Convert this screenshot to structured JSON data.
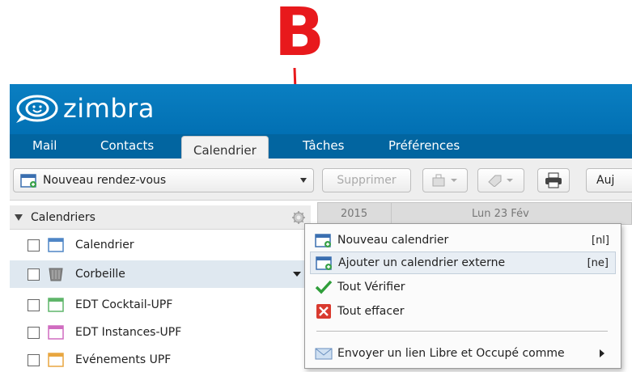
{
  "annotation": {
    "letter": "B",
    "color": "#e8191c"
  },
  "app": {
    "logo_text": "zimbra",
    "header_color": "#0a7fc2"
  },
  "tabs": [
    {
      "label": "Mail"
    },
    {
      "label": "Contacts"
    },
    {
      "label": "Calendrier",
      "active": true
    },
    {
      "label": "Tâches"
    },
    {
      "label": "Préférences"
    }
  ],
  "toolbar": {
    "new_appointment": "Nouveau rendez-vous",
    "delete": "Supprimer",
    "today": "Auj"
  },
  "view_header": {
    "year": "2015",
    "day": "Lun 23 Fév"
  },
  "sidebar": {
    "title": "Calendriers",
    "calendars": [
      {
        "label": "Calendrier",
        "color": "#4f86c6",
        "icon": "calendar-icon"
      },
      {
        "label": "Corbeille",
        "icon": "trash-icon",
        "selected": true
      },
      {
        "label": "EDT Cocktail-UPF",
        "color": "#5fb56a",
        "icon": "calendar-icon"
      },
      {
        "label": "EDT Instances-UPF",
        "color": "#d06cc0",
        "icon": "calendar-icon"
      },
      {
        "label": "Evénements UPF",
        "color": "#e8a640",
        "icon": "calendar-icon"
      }
    ]
  },
  "context_menu": {
    "items": [
      {
        "label": "Nouveau calendrier",
        "shortcut": "[nl]",
        "icon": "new-calendar-icon"
      },
      {
        "label": "Ajouter un calendrier externe",
        "shortcut": "[ne]",
        "icon": "external-calendar-icon",
        "hover": true
      },
      {
        "label": "Tout Vérifier",
        "icon": "checkmark-icon"
      },
      {
        "label": "Tout effacer",
        "icon": "clear-icon"
      },
      {
        "label": "Envoyer un lien Libre et Occupé comme",
        "icon": "envelope-icon",
        "submenu": true
      }
    ]
  }
}
